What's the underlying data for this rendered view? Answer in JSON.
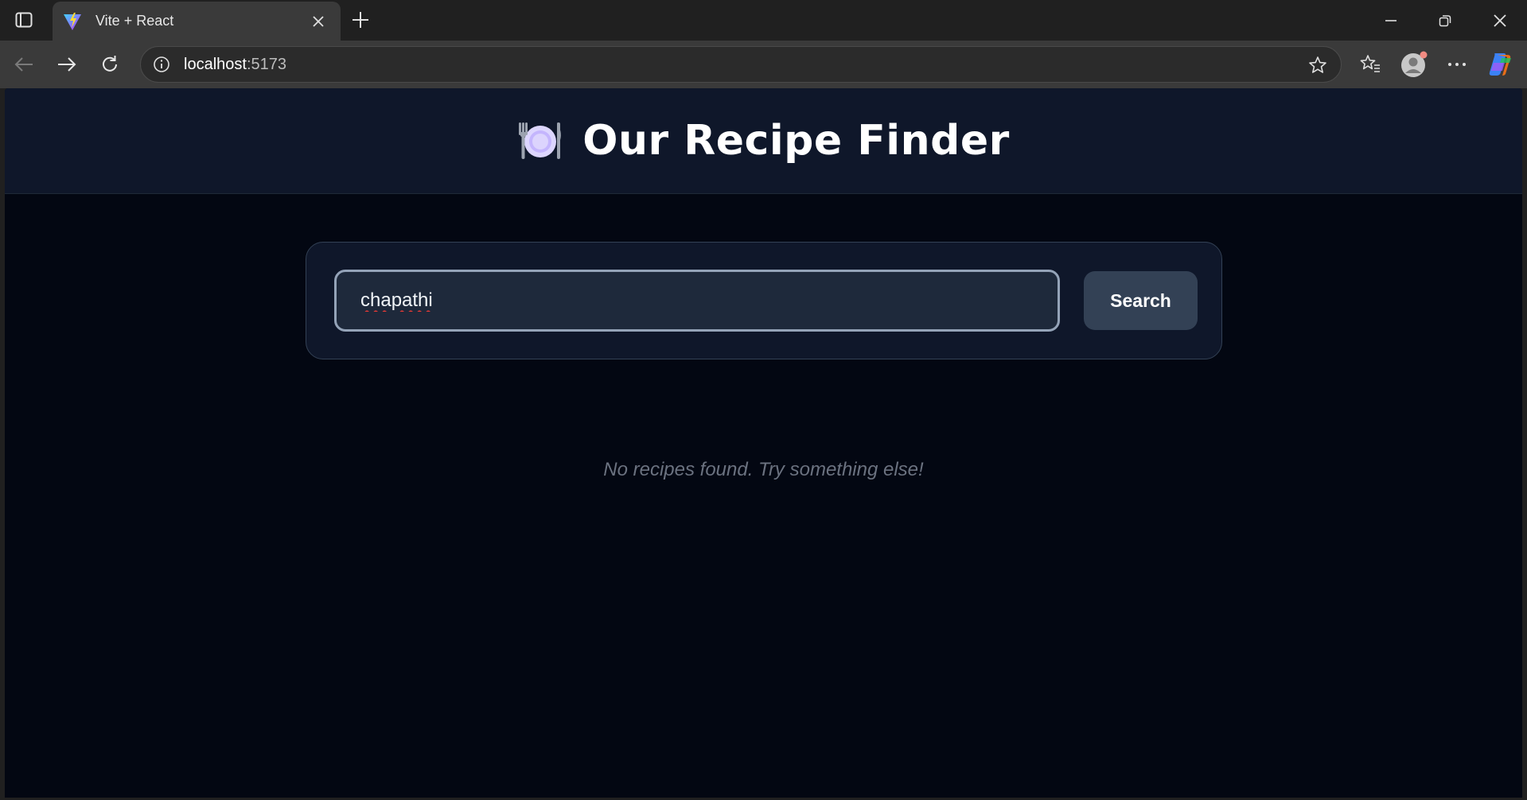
{
  "browser": {
    "tab": {
      "title": "Vite + React"
    },
    "address": {
      "host": "localhost",
      "port": ":5173"
    }
  },
  "app": {
    "title": "Our Recipe Finder",
    "search": {
      "value": "chapathi",
      "button_label": "Search"
    },
    "empty_message": "No recipes found. Try something else!"
  },
  "icons": {
    "tab_actions": "tab-actions-icon",
    "favicon": "vite-logo-icon",
    "close": "close-icon",
    "new_tab": "plus-icon",
    "minimize": "minimize-icon",
    "restore": "restore-icon",
    "window_close": "close-icon",
    "back": "back-arrow-icon",
    "forward": "forward-arrow-icon",
    "reload": "reload-icon",
    "site_info": "info-icon",
    "favorite": "star-icon",
    "favorites": "favorites-icon",
    "profile": "profile-avatar-icon",
    "menu": "more-icon",
    "copilot": "copilot-icon",
    "logo": "plate-cutlery-icon"
  },
  "colors": {
    "page_bg": "#030712",
    "header_bg": "#0f172a",
    "button_bg": "#334155",
    "muted_text": "#6b7280"
  }
}
